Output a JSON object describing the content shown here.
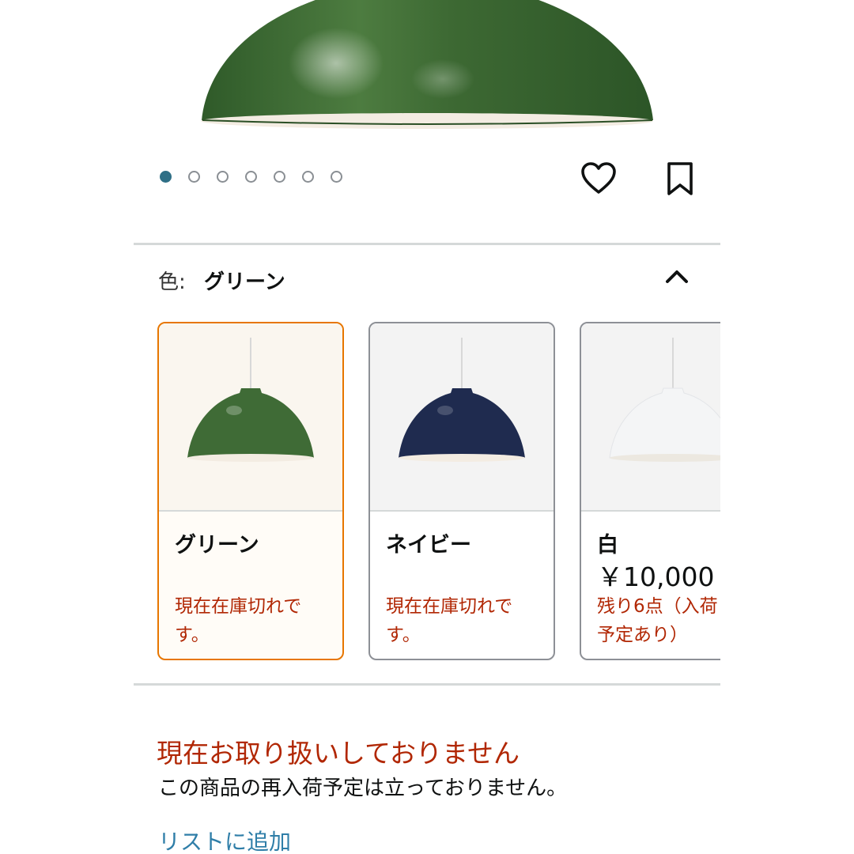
{
  "carousel": {
    "image_count": 7,
    "active_index": 0,
    "product_color_hex": "#3f6b36"
  },
  "actions": {
    "heart_icon": "heart-outline-icon",
    "bookmark_icon": "bookmark-outline-icon"
  },
  "color_selector": {
    "label": "色:",
    "selected_value": "グリーン",
    "toggle_icon": "chevron-up-icon",
    "options": [
      {
        "name": "グリーン",
        "price": "",
        "status": "現在在庫切れです。",
        "selected": true,
        "shade_color": "#3f6b36"
      },
      {
        "name": "ネイビー",
        "price": "",
        "status": "現在在庫切れです。",
        "selected": false,
        "shade_color": "#1f2b4f"
      },
      {
        "name": "白",
        "price": "￥10,000",
        "status": "残り6点（入荷予定あり）",
        "selected": false,
        "shade_color": "#f4f5f6"
      }
    ]
  },
  "availability": {
    "headline": "現在お取り扱いしておりません",
    "note": "この商品の再入荷予定は立っておりません。"
  },
  "list_action": {
    "label": "リストに追加"
  },
  "colors": {
    "accent_orange": "#e77600",
    "alert_red": "#b12704",
    "link_blue": "#2f7ea8",
    "dot_active": "#2f6f86"
  }
}
